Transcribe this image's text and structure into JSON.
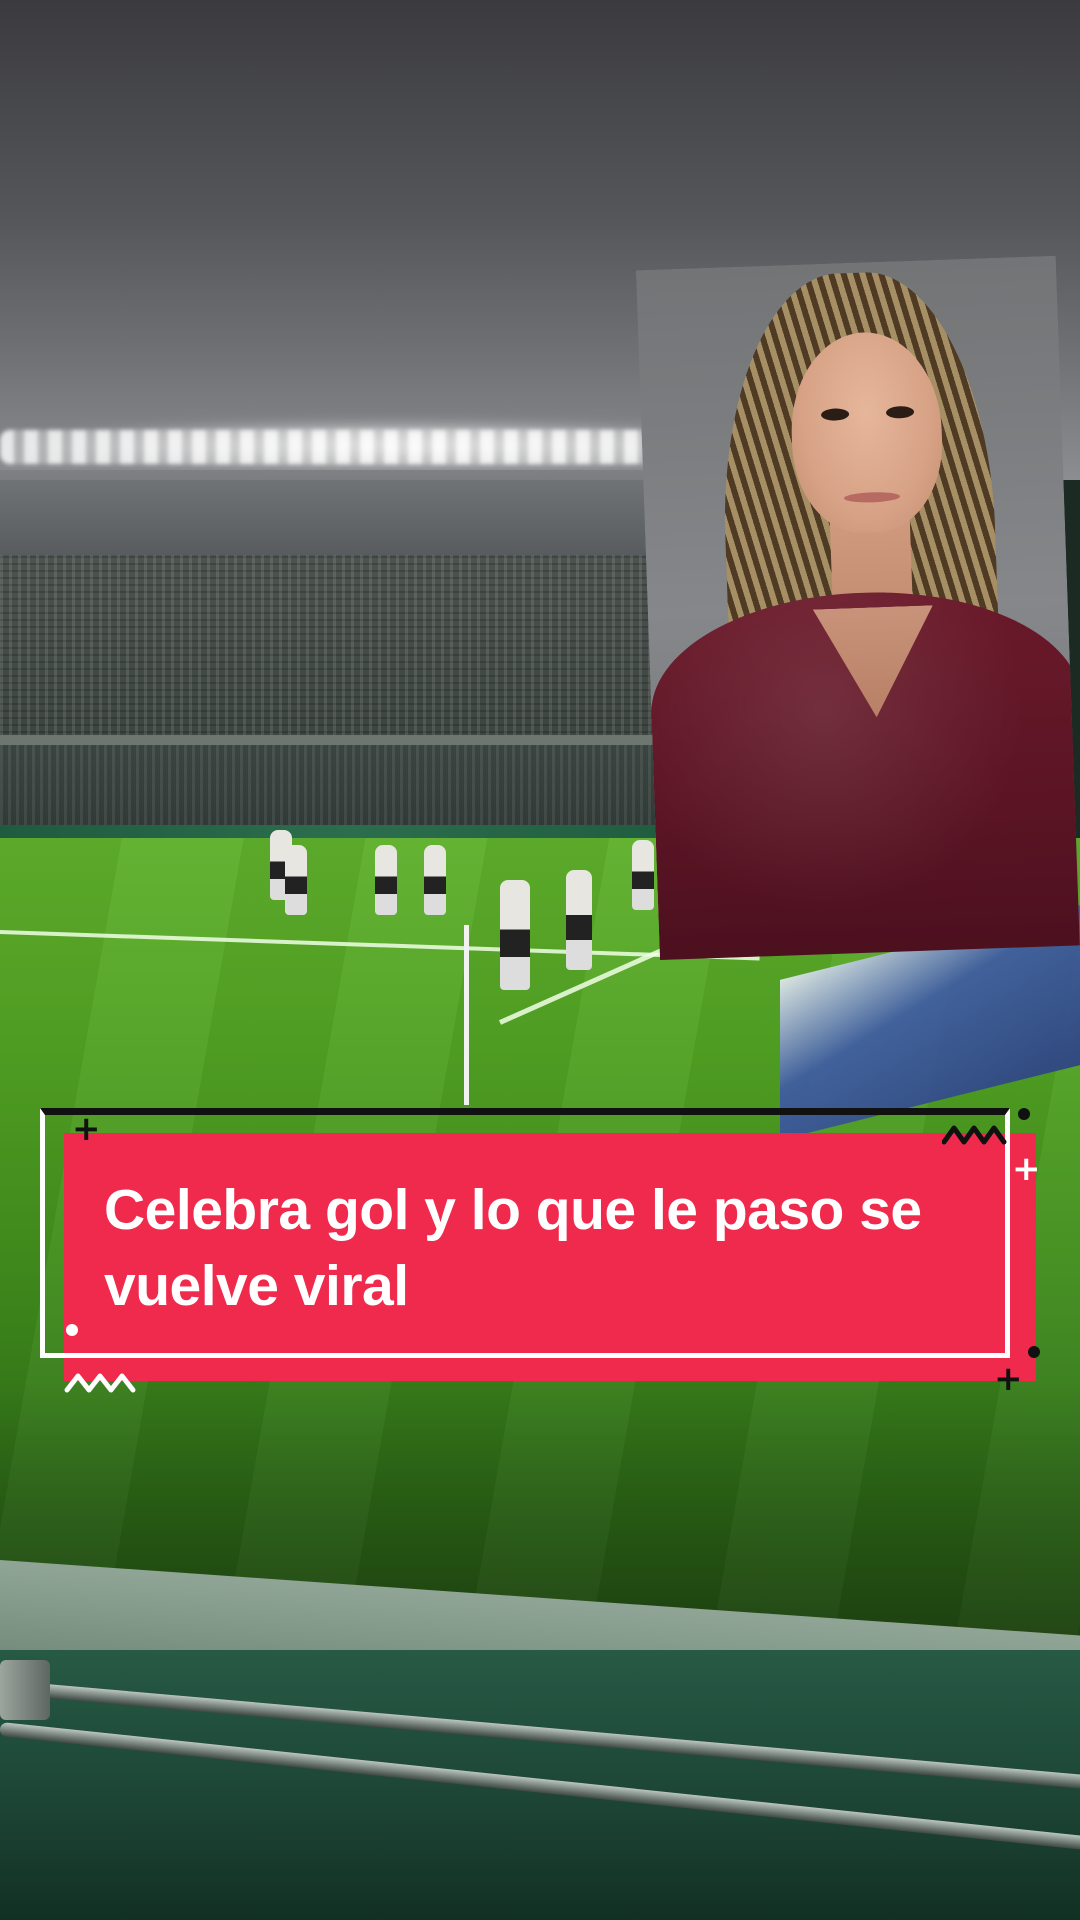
{
  "caption": {
    "text": "Celebra gol y lo que le paso se vuelve viral"
  },
  "colors": {
    "caption_background": "#f02a4c",
    "caption_text": "#ffffff",
    "pitch": "#4f9f22",
    "presenter_top": "#6b1a2a"
  },
  "icons": [
    "plus-icon",
    "zigzag-icon",
    "dot-icon"
  ]
}
